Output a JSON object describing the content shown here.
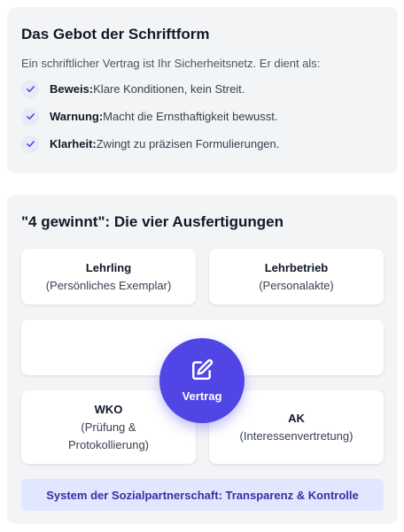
{
  "schriftform": {
    "title": "Das Gebot der Schriftform",
    "intro": "Ein schriftlicher Vertrag ist Ihr Sicherheitsnetz. Er dient als:",
    "items": [
      {
        "term": "Beweis:",
        "text": "Klare Konditionen, kein Streit."
      },
      {
        "term": "Warnung:",
        "text": "Macht die Ernsthaftigkeit bewusst."
      },
      {
        "term": "Klarheit:",
        "text": "Zwingt zu präzisen Formulierungen."
      }
    ]
  },
  "ausfertigungen": {
    "title": "\"4 gewinnt\": Die vier Ausfertigungen",
    "copies": [
      {
        "name": "Lehrling",
        "desc": "(Persönliches Exemplar)"
      },
      {
        "name": "Lehrbetrieb",
        "desc": "(Personalakte)"
      },
      {
        "name": "WKO",
        "desc": "(Prüfung & Protokollierung)"
      },
      {
        "name": "AK",
        "desc": "(Interessenvertretung)"
      }
    ],
    "center": {
      "label": "Vertrag",
      "icon": "edit-icon"
    },
    "banner": "System der Sozialpartnerschaft: Transparenz & Kontrolle"
  },
  "colors": {
    "accent": "#4f46e5",
    "card_bg": "#f3f4f6",
    "banner_bg": "#e0e7ff",
    "banner_text": "#3730a3"
  }
}
